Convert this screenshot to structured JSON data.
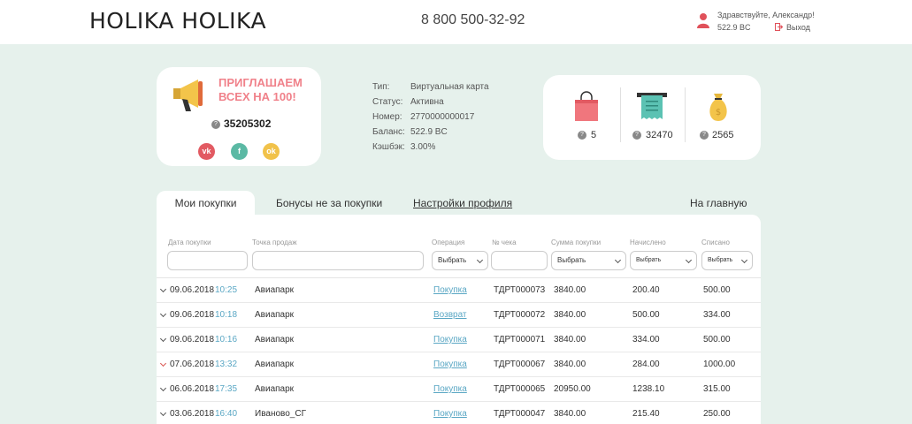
{
  "header": {
    "logo": "HOLIKA HOLIKA",
    "phone": "8 800 500-32-92",
    "greeting": "Здравствуйте, Александр!",
    "balance": "522.9 BC",
    "logout": "Выход"
  },
  "promo": {
    "line1": "ПРИГЛАШАЕМ",
    "line2": "ВСЕХ НА 100!",
    "code": "35205302",
    "social": [
      "vk",
      "facebook",
      "odnoklassniki"
    ]
  },
  "card": {
    "rows": [
      {
        "label": "Тип:",
        "value": "Виртуальная карта"
      },
      {
        "label": "Статус:",
        "value": "Активна"
      },
      {
        "label": "Номер:",
        "value": "2770000000017"
      },
      {
        "label": "Баланс:",
        "value": "522.9 BC"
      },
      {
        "label": "Кэшбэк:",
        "value": "3.00%"
      }
    ]
  },
  "stats": {
    "purchases": "5",
    "receipts": "32470",
    "bonuses": "2565"
  },
  "tabs": {
    "my_purchases": "Мои покупки",
    "bonuses_other": "Бонусы не за покупки",
    "profile_settings": "Настройки профиля",
    "home": "На главную"
  },
  "filters": {
    "date": "Дата покупки",
    "point": "Точка продаж",
    "operation": "Операция",
    "receipt": "№ чека",
    "sum": "Сумма покупки",
    "accrued": "Начислено",
    "spent": "Списано",
    "select": "Выбрать"
  },
  "rows": [
    {
      "date": "09.06.2018",
      "time": "10:25",
      "point": "Авиапарк",
      "op": "Покупка",
      "receipt": "ТДРТ000073",
      "sum": "3840.00",
      "accrued": "200.40",
      "spent": "500.00",
      "expcolor": "#555"
    },
    {
      "date": "09.06.2018",
      "time": "10:18",
      "point": "Авиапарк",
      "op": "Возврат",
      "receipt": "ТДРТ000072",
      "sum": "3840.00",
      "accrued": "500.00",
      "spent": "334.00",
      "expcolor": "#555"
    },
    {
      "date": "09.06.2018",
      "time": "10:16",
      "point": "Авиапарк",
      "op": "Покупка",
      "receipt": "ТДРТ000071",
      "sum": "3840.00",
      "accrued": "334.00",
      "spent": "500.00",
      "expcolor": "#555"
    },
    {
      "date": "07.06.2018",
      "time": "13:32",
      "point": "Авиапарк",
      "op": "Покупка",
      "receipt": "ТДРТ000067",
      "sum": "3840.00",
      "accrued": "284.00",
      "spent": "1000.00",
      "expcolor": "#d9534f"
    },
    {
      "date": "06.06.2018",
      "time": "17:35",
      "point": "Авиапарк",
      "op": "Покупка",
      "receipt": "ТДРТ000065",
      "sum": "20950.00",
      "accrued": "1238.10",
      "spent": "315.00",
      "expcolor": "#555"
    },
    {
      "date": "03.06.2018",
      "time": "16:40",
      "point": "Иваново_СГ",
      "op": "Покупка",
      "receipt": "ТДРТ000047",
      "sum": "3840.00",
      "accrued": "215.40",
      "spent": "250.00",
      "expcolor": "#555"
    }
  ]
}
